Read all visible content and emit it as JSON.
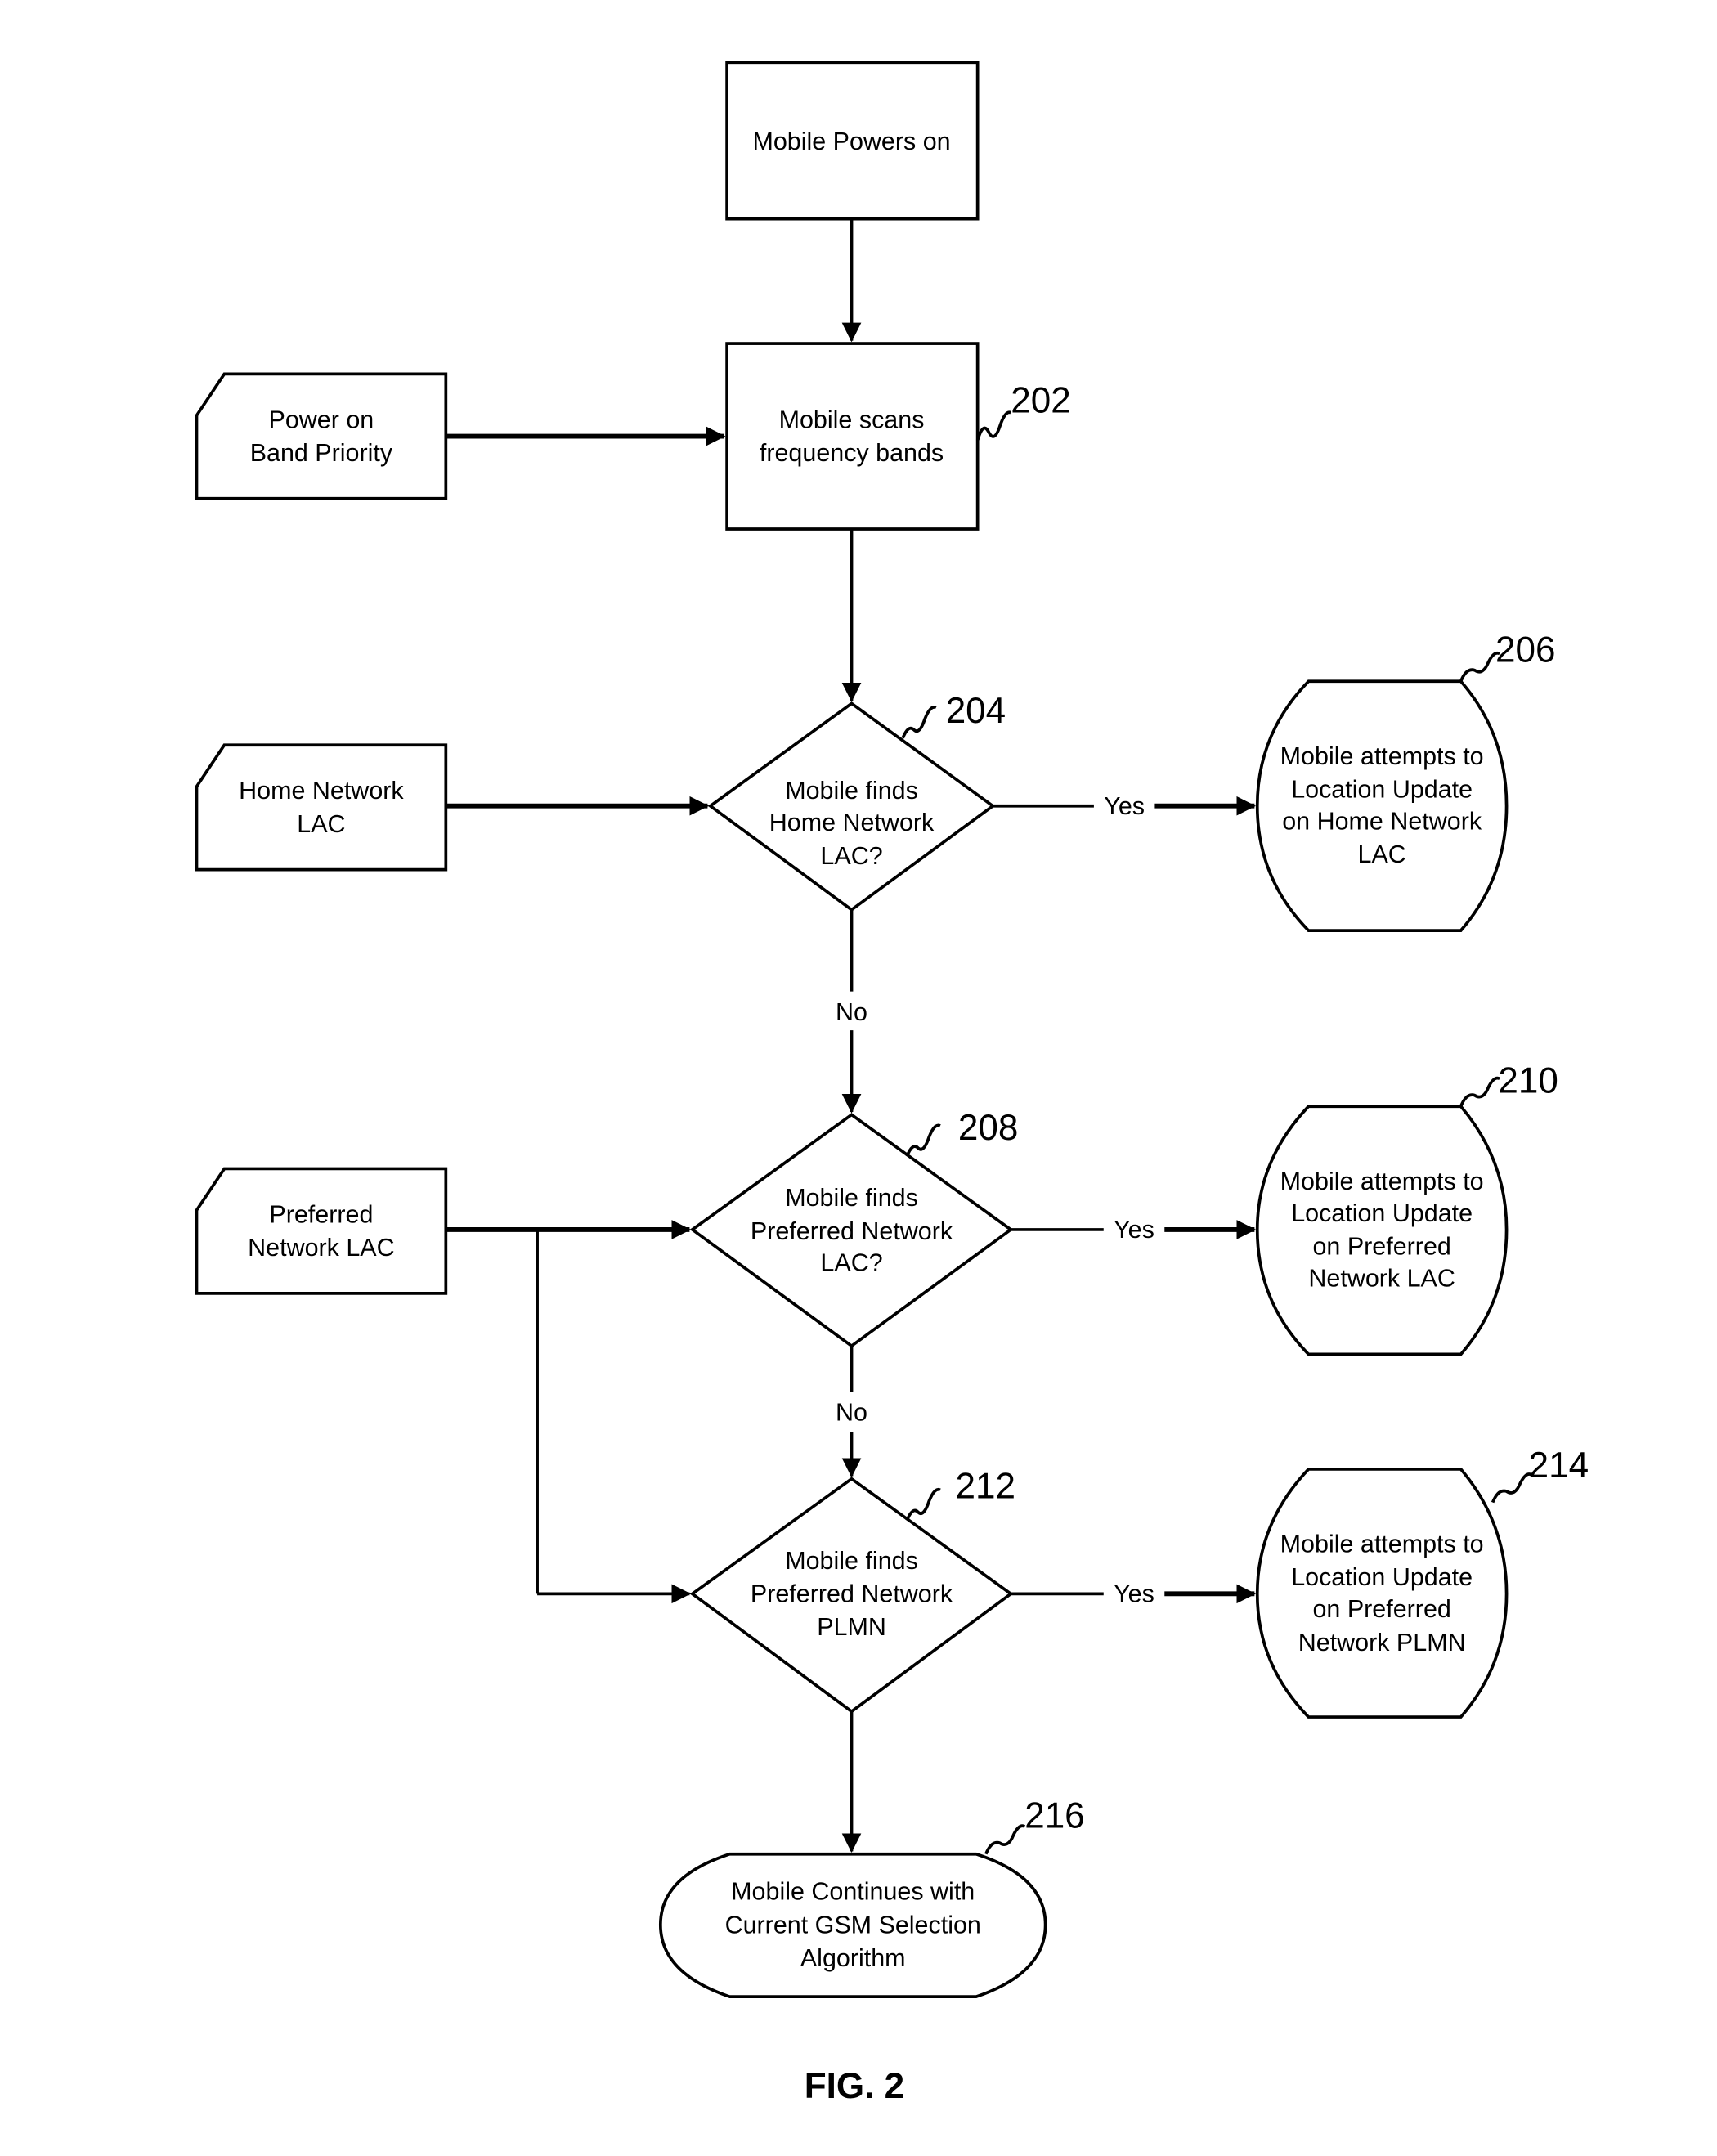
{
  "figure": {
    "caption": "FIG. 2",
    "nodes": {
      "power_on": {
        "lines": [
          "Mobile Powers on"
        ]
      },
      "scan": {
        "ref": "202",
        "lines": [
          "Mobile scans",
          "frequency bands"
        ]
      },
      "band_priority": {
        "lines": [
          "Power on",
          "Band Priority"
        ]
      },
      "home_lac_input": {
        "lines": [
          "Home Network",
          "LAC"
        ]
      },
      "decision_home": {
        "ref": "204",
        "lines": [
          "Mobile finds",
          "Home Network",
          "LAC?"
        ]
      },
      "update_home": {
        "ref": "206",
        "lines": [
          "Mobile attempts to",
          "Location Update",
          "on Home Network",
          "LAC"
        ]
      },
      "pref_lac_input": {
        "lines": [
          "Preferred",
          "Network LAC"
        ]
      },
      "decision_pref_lac": {
        "ref": "208",
        "lines": [
          "Mobile finds",
          "Preferred Network",
          "LAC?"
        ]
      },
      "update_pref_lac": {
        "ref": "210",
        "lines": [
          "Mobile attempts to",
          "Location Update",
          "on Preferred",
          "Network LAC"
        ]
      },
      "decision_pref_plmn": {
        "ref": "212",
        "lines": [
          "Mobile finds",
          "Preferred Network",
          "PLMN"
        ]
      },
      "update_pref_plmn": {
        "ref": "214",
        "lines": [
          "Mobile attempts to",
          "Location Update",
          "on Preferred",
          "Network PLMN"
        ]
      },
      "continue_gsm": {
        "ref": "216",
        "lines": [
          "Mobile Continues with",
          "Current GSM Selection",
          "Algorithm"
        ]
      }
    },
    "edge_labels": {
      "yes": "Yes",
      "no": "No"
    }
  }
}
